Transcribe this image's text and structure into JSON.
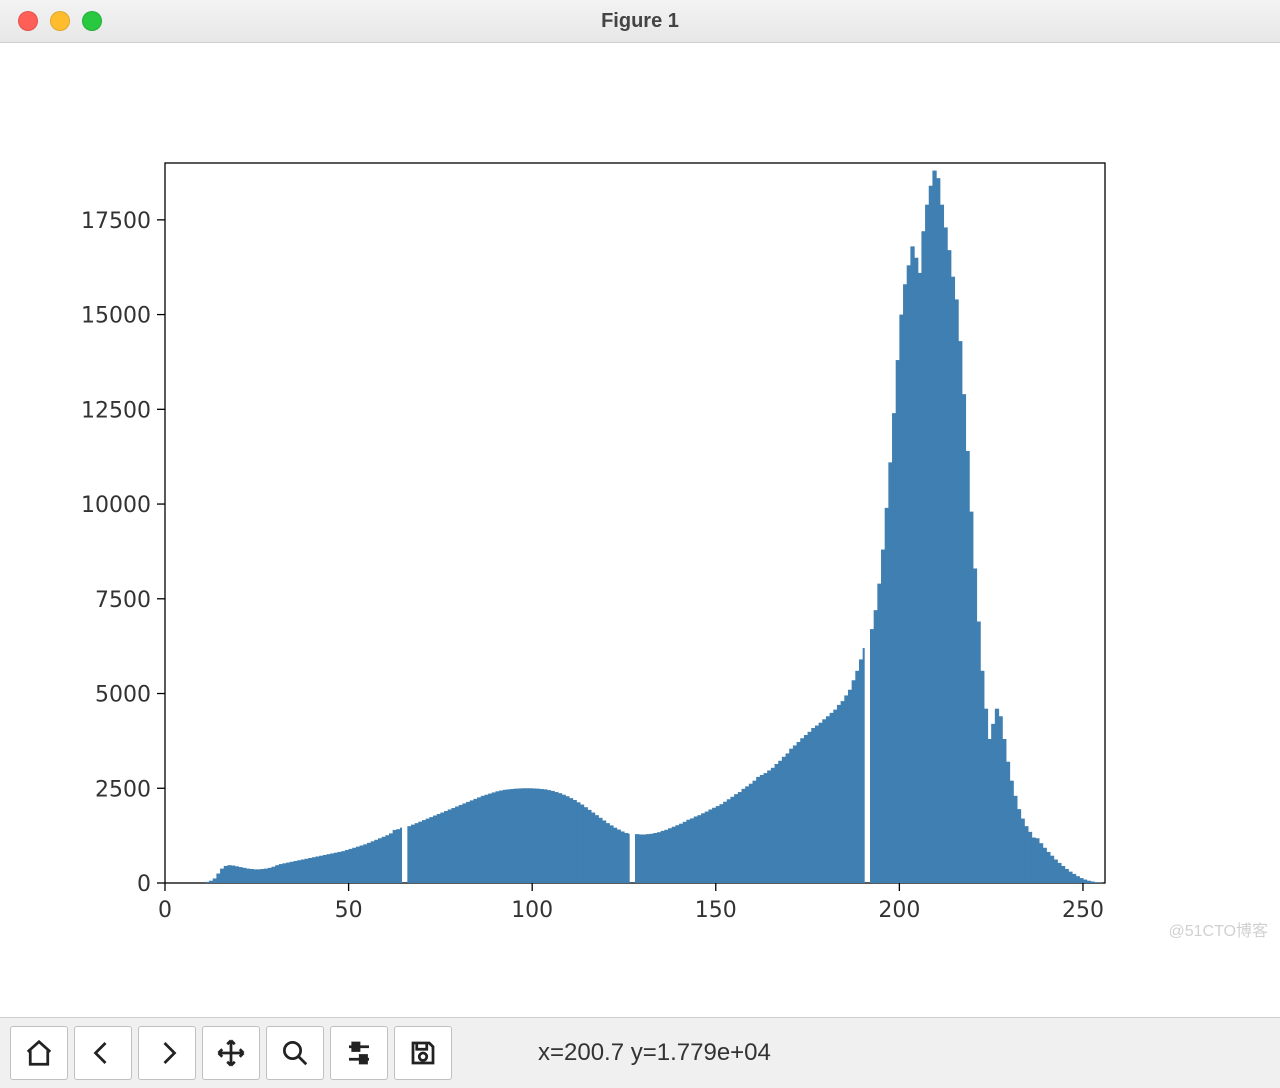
{
  "window": {
    "title": "Figure 1"
  },
  "toolbar": {
    "buttons": [
      {
        "name": "home-button",
        "icon": "home-icon"
      },
      {
        "name": "back-button",
        "icon": "arrow-left-icon"
      },
      {
        "name": "forward-button",
        "icon": "arrow-right-icon"
      },
      {
        "name": "pan-button",
        "icon": "move-icon"
      },
      {
        "name": "zoom-button",
        "icon": "magnify-icon"
      },
      {
        "name": "configure-button",
        "icon": "sliders-icon"
      },
      {
        "name": "save-button",
        "icon": "save-icon"
      }
    ],
    "coord_readout": "x=200.7 y=1.779e+04"
  },
  "watermark": "@51CTO博客",
  "chart_data": {
    "type": "bar",
    "title": "",
    "xlabel": "",
    "ylabel": "",
    "xlim": [
      0,
      256
    ],
    "ylim": [
      0,
      19000
    ],
    "xticks": [
      0,
      50,
      100,
      150,
      200,
      250
    ],
    "yticks": [
      0,
      2500,
      5000,
      7500,
      10000,
      12500,
      15000,
      17500
    ],
    "bar_width": 1,
    "gaps_at": [
      65,
      127,
      191
    ],
    "color": "#3f7fb1",
    "categories": [
      0,
      1,
      2,
      3,
      4,
      5,
      6,
      7,
      8,
      9,
      10,
      11,
      12,
      13,
      14,
      15,
      16,
      17,
      18,
      19,
      20,
      21,
      22,
      23,
      24,
      25,
      26,
      27,
      28,
      29,
      30,
      31,
      32,
      33,
      34,
      35,
      36,
      37,
      38,
      39,
      40,
      41,
      42,
      43,
      44,
      45,
      46,
      47,
      48,
      49,
      50,
      51,
      52,
      53,
      54,
      55,
      56,
      57,
      58,
      59,
      60,
      61,
      62,
      63,
      64,
      65,
      66,
      67,
      68,
      69,
      70,
      71,
      72,
      73,
      74,
      75,
      76,
      77,
      78,
      79,
      80,
      81,
      82,
      83,
      84,
      85,
      86,
      87,
      88,
      89,
      90,
      91,
      92,
      93,
      94,
      95,
      96,
      97,
      98,
      99,
      100,
      101,
      102,
      103,
      104,
      105,
      106,
      107,
      108,
      109,
      110,
      111,
      112,
      113,
      114,
      115,
      116,
      117,
      118,
      119,
      120,
      121,
      122,
      123,
      124,
      125,
      126,
      127,
      128,
      129,
      130,
      131,
      132,
      133,
      134,
      135,
      136,
      137,
      138,
      139,
      140,
      141,
      142,
      143,
      144,
      145,
      146,
      147,
      148,
      149,
      150,
      151,
      152,
      153,
      154,
      155,
      156,
      157,
      158,
      159,
      160,
      161,
      162,
      163,
      164,
      165,
      166,
      167,
      168,
      169,
      170,
      171,
      172,
      173,
      174,
      175,
      176,
      177,
      178,
      179,
      180,
      181,
      182,
      183,
      184,
      185,
      186,
      187,
      188,
      189,
      190,
      191,
      192,
      193,
      194,
      195,
      196,
      197,
      198,
      199,
      200,
      201,
      202,
      203,
      204,
      205,
      206,
      207,
      208,
      209,
      210,
      211,
      212,
      213,
      214,
      215,
      216,
      217,
      218,
      219,
      220,
      221,
      222,
      223,
      224,
      225,
      226,
      227,
      228,
      229,
      230,
      231,
      232,
      233,
      234,
      235,
      236,
      237,
      238,
      239,
      240,
      241,
      242,
      243,
      244,
      245,
      246,
      247,
      248,
      249,
      250,
      251,
      252,
      253,
      254,
      255
    ],
    "values": [
      0,
      0,
      0,
      0,
      0,
      0,
      0,
      0,
      0,
      0,
      0,
      30,
      60,
      120,
      250,
      380,
      450,
      470,
      460,
      440,
      420,
      400,
      380,
      370,
      360,
      360,
      370,
      380,
      400,
      430,
      470,
      500,
      520,
      540,
      560,
      580,
      600,
      620,
      640,
      660,
      680,
      700,
      720,
      740,
      760,
      780,
      800,
      820,
      840,
      870,
      900,
      930,
      960,
      990,
      1020,
      1060,
      1100,
      1140,
      1180,
      1220,
      1260,
      1310,
      1400,
      1420,
      1460,
      0,
      1500,
      1540,
      1580,
      1620,
      1660,
      1700,
      1740,
      1780,
      1820,
      1860,
      1900,
      1940,
      1980,
      2020,
      2060,
      2100,
      2140,
      2180,
      2220,
      2260,
      2300,
      2330,
      2360,
      2390,
      2420,
      2440,
      2460,
      2470,
      2480,
      2490,
      2495,
      2500,
      2500,
      2500,
      2495,
      2490,
      2480,
      2470,
      2450,
      2430,
      2400,
      2370,
      2330,
      2290,
      2240,
      2190,
      2130,
      2070,
      2000,
      1930,
      1860,
      1790,
      1720,
      1650,
      1580,
      1520,
      1460,
      1410,
      1360,
      1320,
      1300,
      0,
      1290,
      1280,
      1280,
      1290,
      1300,
      1320,
      1340,
      1375,
      1405,
      1445,
      1485,
      1525,
      1565,
      1615,
      1670,
      1705,
      1755,
      1790,
      1840,
      1885,
      1940,
      1985,
      2030,
      2080,
      2145,
      2210,
      2275,
      2345,
      2400,
      2485,
      2550,
      2620,
      2700,
      2800,
      2850,
      2900,
      2970,
      3040,
      3140,
      3225,
      3330,
      3420,
      3545,
      3630,
      3720,
      3820,
      3905,
      3990,
      4090,
      4155,
      4230,
      4320,
      4400,
      4490,
      4575,
      4700,
      4800,
      4950,
      5100,
      5350,
      5600,
      5900,
      6200,
      0,
      6700,
      7200,
      7900,
      8800,
      9900,
      11100,
      12400,
      13800,
      15000,
      15800,
      16300,
      16800,
      16500,
      16100,
      17200,
      17900,
      18400,
      18800,
      18600,
      17900,
      17300,
      16700,
      16000,
      15400,
      14300,
      12900,
      11400,
      9800,
      8300,
      6900,
      5600,
      4600,
      3800,
      4200,
      4600,
      4400,
      3800,
      3200,
      2700,
      2300,
      1950,
      1700,
      1500,
      1350,
      1200,
      1180,
      1050,
      930,
      820,
      720,
      620,
      530,
      450,
      370,
      300,
      240,
      180,
      130,
      90,
      60,
      40,
      20,
      10,
      0
    ]
  }
}
